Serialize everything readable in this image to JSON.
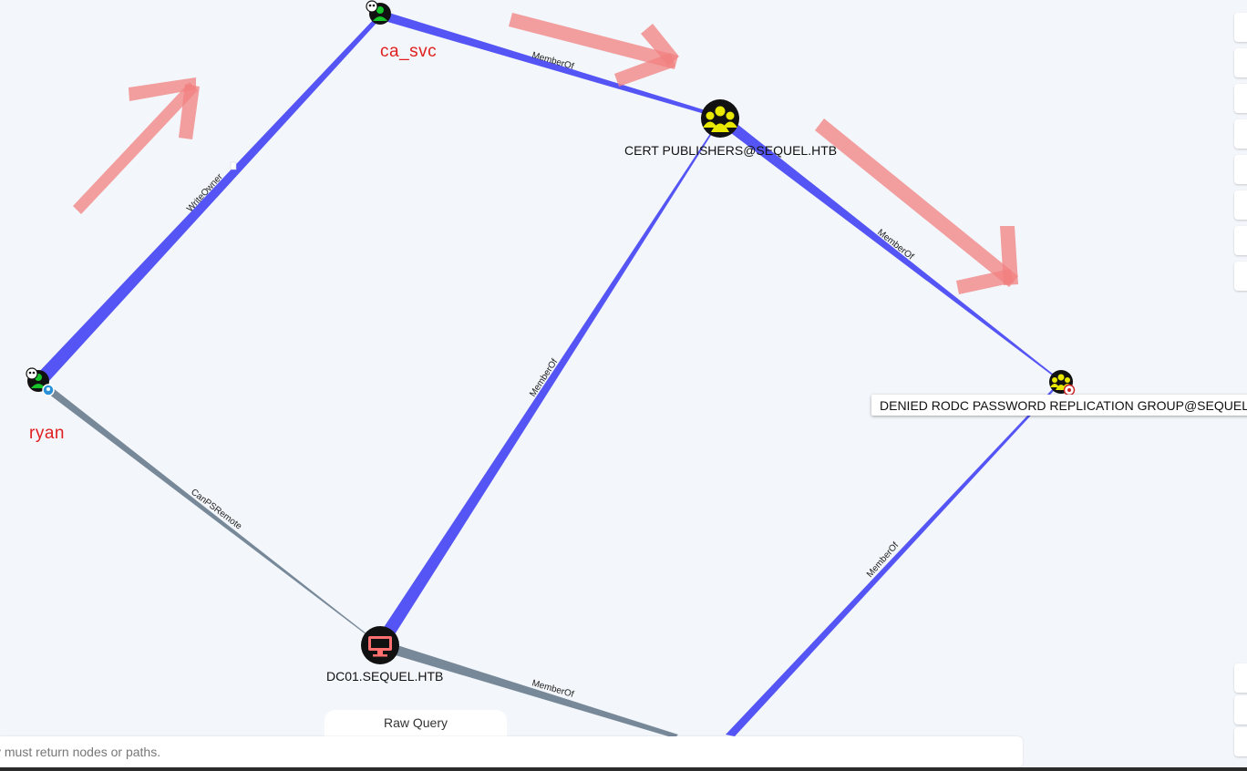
{
  "nodes": {
    "ca_svc": {
      "label": "",
      "annotation": "ca_svc",
      "icon": "user-icon"
    },
    "ryan": {
      "label": "",
      "annotation": "ryan",
      "icon": "user-icon"
    },
    "cert_publishers": {
      "label": "CERT PUBLISHERS@SEQUEL.HTB",
      "icon": "group-icon"
    },
    "denied_rodc": {
      "label": "DENIED RODC PASSWORD REPLICATION GROUP@SEQUEL.HTB",
      "icon": "group-icon"
    },
    "dc01": {
      "label": "DC01.SEQUEL.HTB",
      "icon": "computer-icon"
    }
  },
  "edges": {
    "ryan_to_ca_svc": "WriteOwner",
    "ca_svc_to_cert": "MemberOf",
    "cert_to_denied": "MemberOf",
    "dc01_to_cert": "MemberOf",
    "ryan_to_dc01": "CanPSRemote",
    "denied_down": "MemberOf",
    "dc01_down": "MemberOf"
  },
  "colors": {
    "edge_memberof": "#5555f5",
    "edge_psremote": "#778899",
    "user_node": "#17c42a",
    "group_node": "#e8e800",
    "computer_node": "#ff6f6f",
    "annotation": "#e02020",
    "arrow_overlay": "#f28080"
  },
  "raw_query": {
    "tab_label": "Raw Query",
    "placeholder": "y must return nodes or paths."
  }
}
